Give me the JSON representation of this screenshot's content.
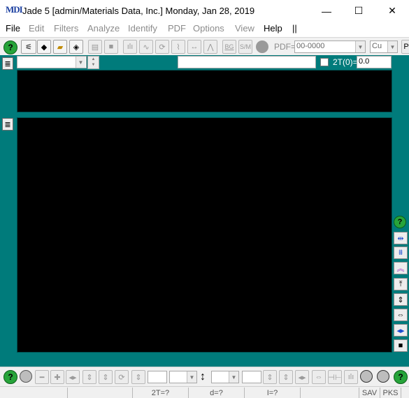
{
  "window": {
    "title": "Jade 5 [admin/Materials Data, Inc.] Monday, Jan 28, 2019",
    "logo_text": "MDI",
    "controls": {
      "minimize": "—",
      "maximize": "☐",
      "close": "✕"
    }
  },
  "menu": {
    "file": "File",
    "edit": "Edit",
    "filters": "Filters",
    "analyze": "Analyze",
    "identify": "Identify",
    "pdf": "PDF",
    "options": "Options",
    "view": "View",
    "help": "Help",
    "separator": "||"
  },
  "toolbar": {
    "help_glyph": "?",
    "pdf_label": "PDF=",
    "pdf_value": "00-0000",
    "radiation_value": "Cu",
    "p_button": "P",
    "bg_label": "BG",
    "sm_label": "S/M"
  },
  "readout_row": {
    "twotheta_label": "2T(0)=",
    "twotheta_value": "0.0"
  },
  "side_grip": "≣",
  "status": {
    "twotheta": "2T=?",
    "d": "d=?",
    "i": "I=?",
    "sav": "SAV",
    "pks": "PKS"
  }
}
